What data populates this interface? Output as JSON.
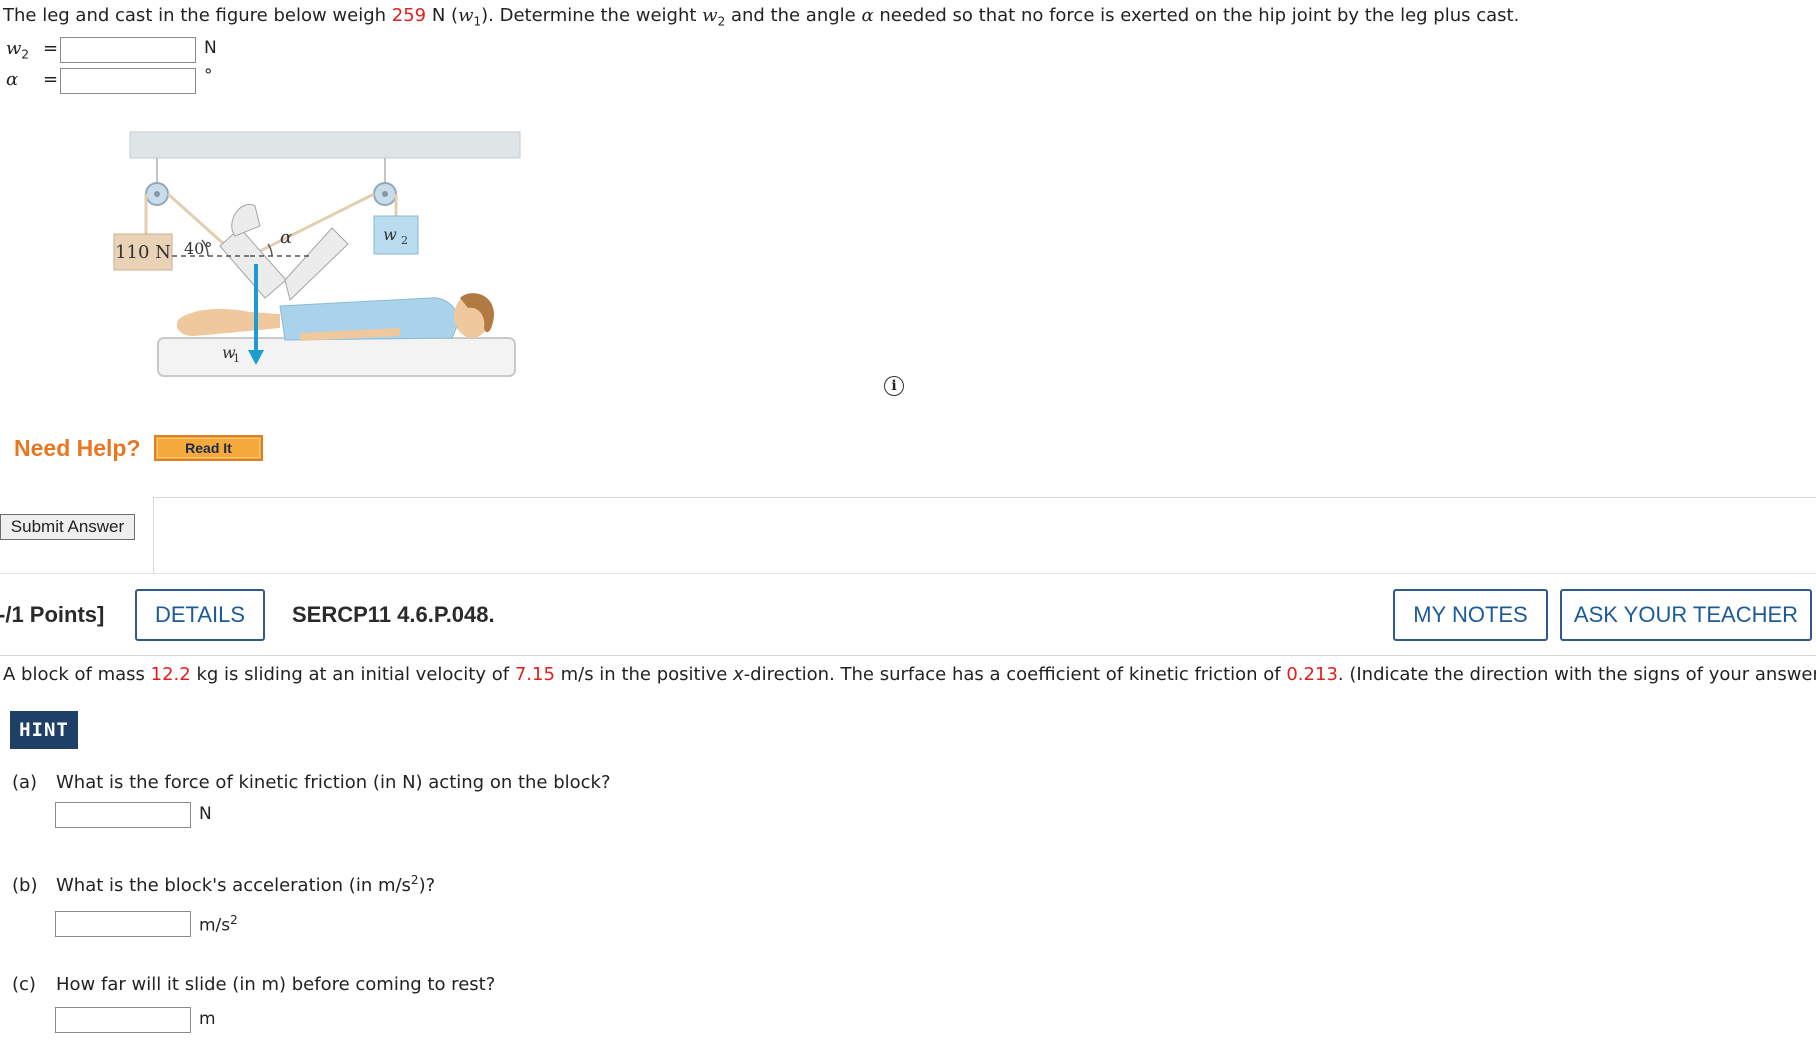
{
  "question1": {
    "text_before_w1": "The leg and cast in the figure below weigh ",
    "w1_value": "259",
    "text_after_w1_a": " N (",
    "w1_symbol": "w",
    "w1_sub": "1",
    "text_after_w1_b": "). Determine the weight ",
    "w2_symbol": "w",
    "w2_sub": "2",
    "text_after_w2_a": " and the angle ",
    "alpha_symbol": "α",
    "text_after_alpha": " needed so that no force is exerted on the hip joint by the leg plus cast.",
    "answers": [
      {
        "symbol": "w",
        "sub": "2",
        "equals": "=",
        "value": "",
        "unit": "N"
      },
      {
        "symbol": "α",
        "sub": "",
        "equals": "=",
        "value": "",
        "unit": "°"
      }
    ],
    "figure": {
      "weight_label": "110 N",
      "angle_label": "40°",
      "alpha_label": "α",
      "w2_label": "w",
      "w2_sub": "2",
      "w1_label": "w",
      "w1_sub": "1"
    },
    "need_help": "Need Help?",
    "read_it": "Read It",
    "submit": "Submit Answer"
  },
  "question2": {
    "points": "-/1 Points]",
    "details": "DETAILS",
    "code": "SERCP11 4.6.P.048.",
    "my_notes": "MY NOTES",
    "ask_teacher": "ASK YOUR TEACHER",
    "text_a": "A block of mass ",
    "mass": "12.2",
    "text_b": " kg is sliding at an initial velocity of ",
    "velocity": "7.15",
    "text_c": " m/s in the positive ",
    "x_symbol": "x",
    "text_d": "-direction. The surface has a coefficient of kinetic friction of ",
    "mu": "0.213",
    "text_e": ". (Indicate the direction with the signs of your answers.)",
    "hint": "HINT",
    "parts": [
      {
        "label": "(a)",
        "question": "What is the force of kinetic friction (in N) acting on the block?",
        "unit": "N",
        "unit_sup": "",
        "value": ""
      },
      {
        "label": "(b)",
        "question_pre": "What is the block's acceleration (in m/s",
        "question_sup": "2",
        "question_post": ")?",
        "unit": "m/s",
        "unit_sup": "2",
        "value": ""
      },
      {
        "label": "(c)",
        "question": "How far will it slide (in m) before coming to rest?",
        "unit": "m",
        "unit_sup": "",
        "value": ""
      }
    ]
  },
  "colors": {
    "highlight_red": "#e0201c",
    "need_help_orange": "#e87722",
    "hint_navy": "#1e3f66",
    "button_blue": "#1d5a9a"
  },
  "icons": [
    "info-icon"
  ]
}
